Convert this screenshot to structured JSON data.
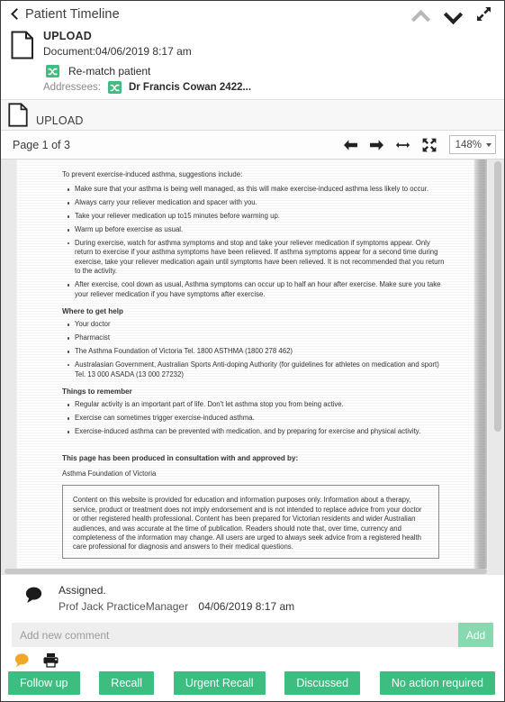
{
  "topbar": {
    "title": "Patient Timeline",
    "back_icon": "back-chevron-icon",
    "prev_icon": "chevron-up-icon",
    "next_icon": "chevron-down-icon",
    "expand_icon": "expand-arrows-icon"
  },
  "document_summary": {
    "file_icon": "document-page-icon",
    "kind": "UPLOAD",
    "date_line": "Document:04/06/2019 8:17 am",
    "rematch": {
      "icon": "shuffle-icon",
      "label": "Re-match patient"
    },
    "addressees": {
      "label": "Addressees:",
      "icon": "shuffle-icon",
      "name": "Dr Francis Cowan 2422..."
    }
  },
  "upload_strip": {
    "file_icon": "document-page-icon",
    "label": "UPLOAD"
  },
  "viewer_toolbar": {
    "page_indicator": "Page 1 of 3",
    "prev_page_icon": "arrow-left-icon",
    "next_page_icon": "arrow-right-icon",
    "fit_width_icon": "fit-width-icon",
    "fit_page_icon": "fit-page-icon",
    "zoom_value": "148%"
  },
  "document": {
    "lead": "To prevent exercise-induced asthma, suggestions include:",
    "prevent_bullets": [
      "Make sure that your asthma is being well managed, as this will make exercise-induced asthma less likely to occur.",
      "Always carry your reliever medication and spacer with you.",
      "Take your reliever medication up to15 minutes before warming up.",
      "Warm up before exercise as usual.",
      "During exercise, watch for asthma symptoms and stop and take your reliever medication if symptoms appear. Only return to exercise if your asthma symptoms have been relieved. If asthma symptoms appear for a second time during exercise, take your reliever medication again until symptoms have been relieved. It is not recommended that you return to the activity.",
      "After exercise, cool down as usual, Asthma symptoms can occur up to half an hour after exercise. Make sure you take your reliever medication if you have symptoms after exercise."
    ],
    "help_heading": "Where to get help",
    "help_bullets": [
      "Your doctor",
      "Pharmacist",
      "The Asthma Foundation of Victoria Tel. 1800 ASTHMA (1800 278 462)",
      "Australasian Government, Australian Sports Anti-doping Authority (for guidelines for athletes on medication and sport) Tel. 13 000 ASADA (13 000 27232)"
    ],
    "remember_heading": "Things to remember",
    "remember_bullets": [
      "Regular activity is an important part of life. Don't let asthma stop you from being active.",
      "Exercise can sometimes trigger exercise-induced asthma.",
      "Exercise-induced asthma can be prevented with medication, and by preparing for exercise and physical activity."
    ],
    "approved_heading": "This page has been produced in consultation with and approved by:",
    "approved_org": "Asthma Foundation of Victoria",
    "disclaimer": "Content on this website is provided for education and information purposes only. Information about a therapy, service, product or treatment does not imply endorsement and is not intended to replace advice from your doctor or other registered health professional. Content has been prepared for Victorian residents and wider Australian audiences, and was accurate at the time of publication. Readers should note that, over time, currency and completeness of the information may change. All users are urged to always seek advice from a registered health care professional for diagnosis and answers to their medical questions."
  },
  "comments": {
    "bubble_icon": "comment-bubble-icon",
    "entry_text": "Assigned.",
    "entry_author": "Prof Jack PracticeManager",
    "entry_time": "04/06/2019 8:17 am",
    "input_placeholder": "Add new comment",
    "input_value": "",
    "add_label": "Add"
  },
  "footer": {
    "comment_icon": "comment-bubble-icon",
    "print_icon": "printer-icon",
    "actions": [
      {
        "label": "Follow up"
      },
      {
        "label": "Recall"
      },
      {
        "label": "Urgent Recall"
      },
      {
        "label": "Discussed"
      },
      {
        "label": "No action required"
      }
    ]
  },
  "colors": {
    "accent_green": "#3dbd80",
    "add_button_green": "#87d9b0",
    "comment_icon_orange": "#f0a82a",
    "viewer_bg": "#e9e9e9"
  }
}
